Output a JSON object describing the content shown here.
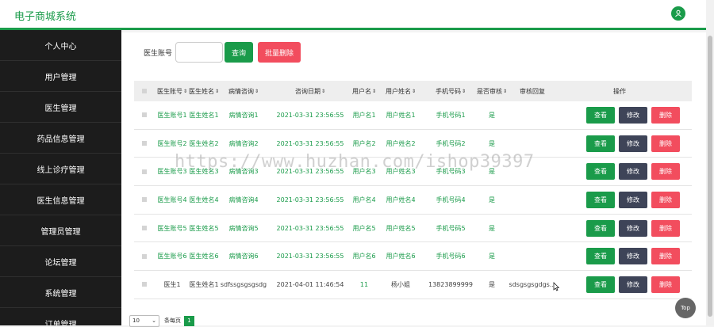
{
  "app": {
    "title": "电子商城系统"
  },
  "sidebar": {
    "items": [
      {
        "label": "个人中心"
      },
      {
        "label": "用户管理"
      },
      {
        "label": "医生管理"
      },
      {
        "label": "药品信息管理"
      },
      {
        "label": "线上诊疗管理"
      },
      {
        "label": "医生信息管理"
      },
      {
        "label": "管理员管理"
      },
      {
        "label": "论坛管理"
      },
      {
        "label": "系统管理"
      },
      {
        "label": "订单管理"
      }
    ]
  },
  "search": {
    "label": "医生账号",
    "value": "",
    "query_label": "查询",
    "batch_delete_label": "批量删除"
  },
  "table": {
    "headers": [
      "医生账号",
      "医生姓名",
      "病情咨询",
      "咨询日期",
      "用户名",
      "用户姓名",
      "手机号码",
      "是否审核",
      "审核回复",
      "操作"
    ],
    "rows": [
      [
        "医生账号1",
        "医生姓名1",
        "病情咨询1",
        "2021-03-31 23:56:55",
        "用户名1",
        "用户姓名1",
        "手机号码1",
        "是",
        ""
      ],
      [
        "医生账号2",
        "医生姓名2",
        "病情咨询2",
        "2021-03-31 23:56:55",
        "用户名2",
        "用户姓名2",
        "手机号码2",
        "是",
        ""
      ],
      [
        "医生账号3",
        "医生姓名3",
        "病情咨询3",
        "2021-03-31 23:56:55",
        "用户名3",
        "用户姓名3",
        "手机号码3",
        "是",
        ""
      ],
      [
        "医生账号4",
        "医生姓名4",
        "病情咨询4",
        "2021-03-31 23:56:55",
        "用户名4",
        "用户姓名4",
        "手机号码4",
        "是",
        ""
      ],
      [
        "医生账号5",
        "医生姓名5",
        "病情咨询5",
        "2021-03-31 23:56:55",
        "用户名5",
        "用户姓名5",
        "手机号码5",
        "是",
        ""
      ],
      [
        "医生账号6",
        "医生姓名6",
        "病情咨询6",
        "2021-03-31 23:56:55",
        "用户名6",
        "用户姓名6",
        "手机号码6",
        "是",
        ""
      ],
      [
        "医生1",
        "医生姓名1",
        "sdfssgsgsgsdg",
        "2021-04-01 11:46:54",
        "11",
        "杨小姐",
        "13823899999",
        "是",
        "sdsgsgsgdgs..."
      ]
    ],
    "actions": {
      "view": "查看",
      "edit": "修改",
      "delete": "删除"
    }
  },
  "pager": {
    "page_size": "10",
    "per_page_label": "条每页",
    "current_page": "1"
  },
  "top_button": "Top",
  "watermark": "https://www.huzhan.com/ishop39397",
  "colors": {
    "primary": "#1a9b4a",
    "danger": "#f24d5e",
    "dark": "#3e4458",
    "sidebar": "#1c1c1c"
  }
}
